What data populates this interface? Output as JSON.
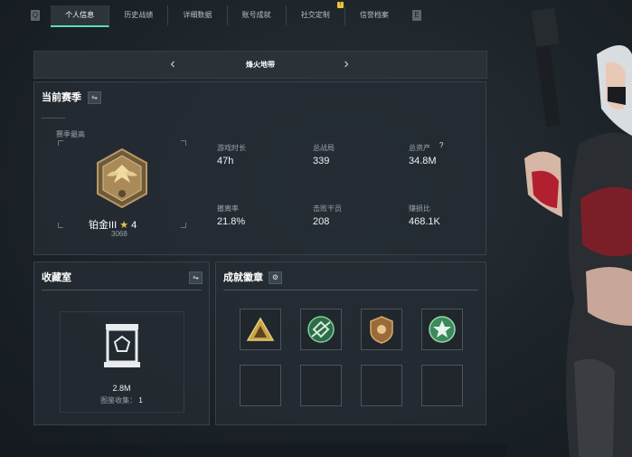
{
  "tabs": {
    "items": [
      {
        "label": "个人信息"
      },
      {
        "label": "历史战绩"
      },
      {
        "label": "详细数据"
      },
      {
        "label": "账号成就"
      },
      {
        "label": "社交定制"
      },
      {
        "label": "信誉档案"
      }
    ],
    "active_index": 0,
    "left_key": "Q",
    "right_key": "E",
    "notice_badge": "!"
  },
  "mode_selector": {
    "label": "烽火地带"
  },
  "season": {
    "title": "当前赛季",
    "highest_label": "赛季最高",
    "rank_name": "铂金III",
    "rank_stars": "4",
    "rank_score": "3068",
    "stats": [
      {
        "label": "游戏时长",
        "value": "47h"
      },
      {
        "label": "总战局",
        "value": "339"
      },
      {
        "label": "总资产",
        "value": "34.8M",
        "help": "?"
      },
      {
        "label": "撤离率",
        "value": "21.8%"
      },
      {
        "label": "击败干员",
        "value": "208"
      },
      {
        "label": "赚损比",
        "value": "468.1K"
      }
    ]
  },
  "collection": {
    "title": "收藏室",
    "value": "2.8M",
    "collect_label": "图鉴收集：",
    "collect_count": "1"
  },
  "badges": {
    "title": "成就徽章",
    "colors": {
      "gold": "#c9a24a",
      "green": "#3c8a5a",
      "bronze": "#9a6a3a"
    }
  },
  "colors": {
    "accent": "#57e0b0",
    "notice": "#f2c230"
  }
}
